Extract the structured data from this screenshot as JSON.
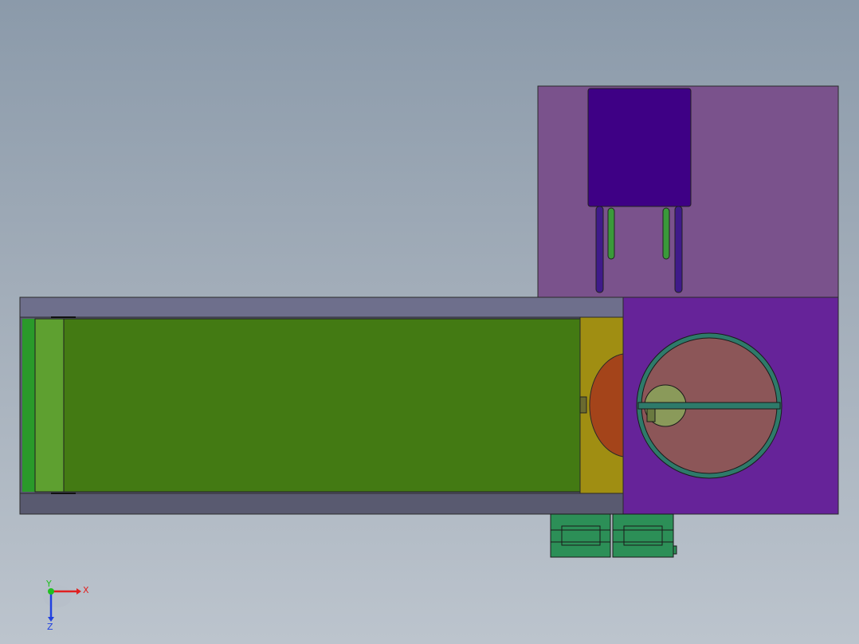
{
  "viewport": {
    "background_top": "#8b9aaa",
    "background_bottom": "#bcc4cd"
  },
  "colors": {
    "frame_rail_top": "#6e6f8c",
    "frame_rail_bottom": "#595a70",
    "belt": "#437a13",
    "belt_roller_left": "#2a9a2a",
    "belt_roller_edge": "#63a83a",
    "end_block": "#a08e12",
    "half_disc": "#a4441a",
    "motor_box": "#662399",
    "upper_box": "#7a528c",
    "hopper": "#3e0085",
    "legs": "#3f1a8a",
    "leg_inner": "#3a9a3a",
    "disc_ring": "#2e7a6a",
    "disc_fill": "#8c5658",
    "disc_small": "#8a9a5a",
    "connectors": "#2c8f57"
  },
  "triad": {
    "x_label": "X",
    "y_label": "Y",
    "z_label": "Z",
    "x_color": "#e02020",
    "y_color": "#20c020",
    "z_color": "#2040e0"
  }
}
